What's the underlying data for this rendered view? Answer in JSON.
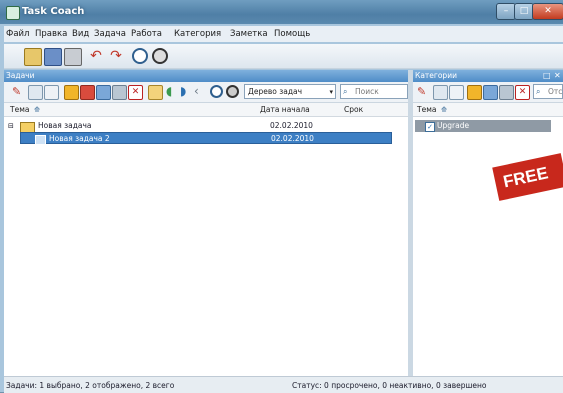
{
  "window": {
    "title": "Task Coach"
  },
  "menu": [
    "Файл",
    "Правка",
    "Вид",
    "Задача",
    "Работа",
    "Категория",
    "Заметка",
    "Помощь"
  ],
  "tasks_pane": {
    "title": "Задачи",
    "view_combo": "Дерево задач",
    "search_placeholder": "Поиск",
    "columns": {
      "subject": "Тема",
      "start_date": "Дата начала",
      "due": "Срок"
    },
    "rows": [
      {
        "subject": "Новая задача",
        "start_date": "02.02.2010",
        "due": "",
        "selected": false,
        "indent": 0
      },
      {
        "subject": "Новая задача 2",
        "start_date": "02.02.2010",
        "due": "",
        "selected": true,
        "indent": 1
      }
    ]
  },
  "categories_pane": {
    "title": "Категории",
    "search_placeholder": "Отс",
    "column_subject": "Тема",
    "items": [
      {
        "label": "Upgrade",
        "checked": true
      }
    ]
  },
  "badge": "FREE",
  "status": {
    "left": "Задачи: 1 выбрано, 2 отображено, 2 всего",
    "right": "Статус: 0 просрочено, 0 неактивно, 0 завершено"
  }
}
